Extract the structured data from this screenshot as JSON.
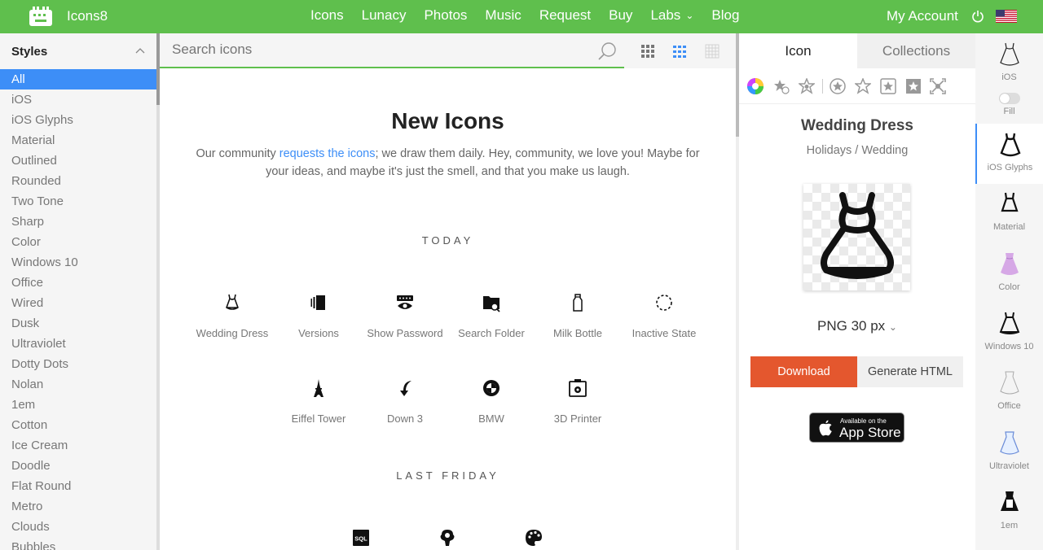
{
  "header": {
    "brand": "Icons8",
    "nav": [
      {
        "label": "Icons"
      },
      {
        "label": "Lunacy"
      },
      {
        "label": "Photos"
      },
      {
        "label": "Music"
      },
      {
        "label": "Request"
      },
      {
        "label": "Buy"
      },
      {
        "label": "Labs"
      },
      {
        "label": "Blog"
      }
    ],
    "account": "My Account",
    "icons": [
      "logo-icon",
      "power-icon",
      "us-flag-icon",
      "chevron-down-icon"
    ]
  },
  "sidebar": {
    "title": "Styles",
    "items": [
      {
        "label": "All",
        "active": true
      },
      {
        "label": "iOS"
      },
      {
        "label": "iOS Glyphs"
      },
      {
        "label": "Material"
      },
      {
        "label": "Outlined"
      },
      {
        "label": "Rounded"
      },
      {
        "label": "Two Tone"
      },
      {
        "label": "Sharp"
      },
      {
        "label": "Color"
      },
      {
        "label": "Windows 10"
      },
      {
        "label": "Office"
      },
      {
        "label": "Wired"
      },
      {
        "label": "Dusk"
      },
      {
        "label": "Ultraviolet"
      },
      {
        "label": "Dotty Dots"
      },
      {
        "label": "Nolan"
      },
      {
        "label": "1em"
      },
      {
        "label": "Cotton"
      },
      {
        "label": "Ice Cream"
      },
      {
        "label": "Doodle"
      },
      {
        "label": "Flat Round"
      },
      {
        "label": "Metro"
      },
      {
        "label": "Clouds"
      },
      {
        "label": "Bubbles"
      }
    ]
  },
  "search": {
    "placeholder": "Search icons"
  },
  "main": {
    "title": "New Icons",
    "desc_pre": "Our community ",
    "desc_link": "requests the icons",
    "desc_post": "; we draw them daily. Hey, community, we love you! Maybe for your ideas, and maybe it's just the smell, and that you make us laugh.",
    "sections": [
      {
        "label": "TODAY",
        "icons": [
          {
            "label": "Wedding Dress",
            "icon": "wedding-dress-icon"
          },
          {
            "label": "Versions",
            "icon": "versions-icon"
          },
          {
            "label": "Show Password",
            "icon": "show-password-icon"
          },
          {
            "label": "Search Folder",
            "icon": "search-folder-icon"
          },
          {
            "label": "Milk Bottle",
            "icon": "milk-bottle-icon"
          },
          {
            "label": "Inactive State",
            "icon": "inactive-state-icon"
          },
          {
            "label": "Eiffel Tower",
            "icon": "eiffel-tower-icon"
          },
          {
            "label": "Down 3",
            "icon": "down-arrow-icon"
          },
          {
            "label": "BMW",
            "icon": "bmw-icon"
          },
          {
            "label": "3D Printer",
            "icon": "3d-printer-icon"
          }
        ]
      },
      {
        "label": "LAST FRIDAY",
        "icons": [
          {
            "label": "",
            "icon": "sql-icon",
            "text": "SQL"
          },
          {
            "label": "",
            "icon": "brain-gear-icon"
          },
          {
            "label": "",
            "icon": "palette-icon"
          }
        ]
      }
    ]
  },
  "panel": {
    "tabs": [
      {
        "label": "Icon",
        "active": true
      },
      {
        "label": "Collections"
      }
    ],
    "icon_name": "Wedding Dress",
    "category": "Holidays / Wedding",
    "size_option": "PNG 30 px",
    "download": "Download",
    "generate": "Generate HTML",
    "appstore_small": "Available on the",
    "appstore_big": "App Store"
  },
  "strip": {
    "fill_label": "Fill",
    "items": [
      {
        "label": "iOS"
      },
      {
        "label": "iOS Glyphs",
        "selected": true
      },
      {
        "label": "Material"
      },
      {
        "label": "Color"
      },
      {
        "label": "Windows 10"
      },
      {
        "label": "Office"
      },
      {
        "label": "Ultraviolet"
      },
      {
        "label": "1em"
      }
    ]
  },
  "colors": {
    "brand_green": "#5fbf4d",
    "accent_blue": "#3d8ef7",
    "download_orange": "#e4572e"
  }
}
